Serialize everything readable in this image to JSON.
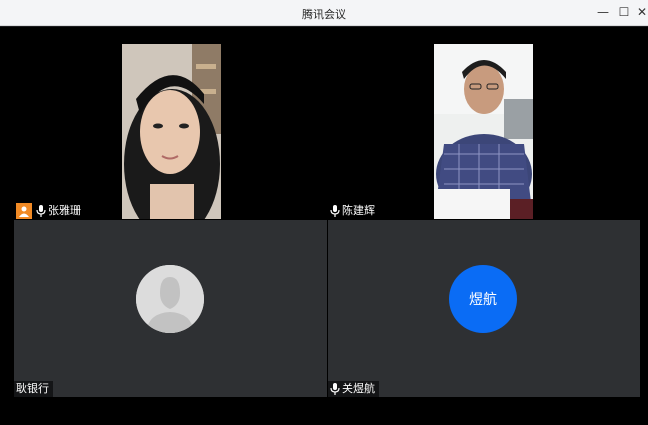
{
  "window": {
    "title": "腾讯会议",
    "controls": {
      "minimize": "—",
      "maximize": "☐",
      "close": "✕"
    }
  },
  "participants": [
    {
      "name": "张雅珊",
      "host": true,
      "mic": "on",
      "video": "on"
    },
    {
      "name": "陈建辉",
      "host": false,
      "mic": "on",
      "video": "on"
    },
    {
      "name": "耿银行",
      "host": false,
      "mic": "none",
      "video": "off",
      "avatar": "default-person-icon"
    },
    {
      "name": "关煜航",
      "host": false,
      "mic": "on",
      "video": "off",
      "avatar_text": "煜航",
      "avatar_color": "#0a6cf5"
    }
  ],
  "colors": {
    "host_badge": "#f18a25",
    "tile_off": "#2e3033",
    "background": "#000000"
  }
}
